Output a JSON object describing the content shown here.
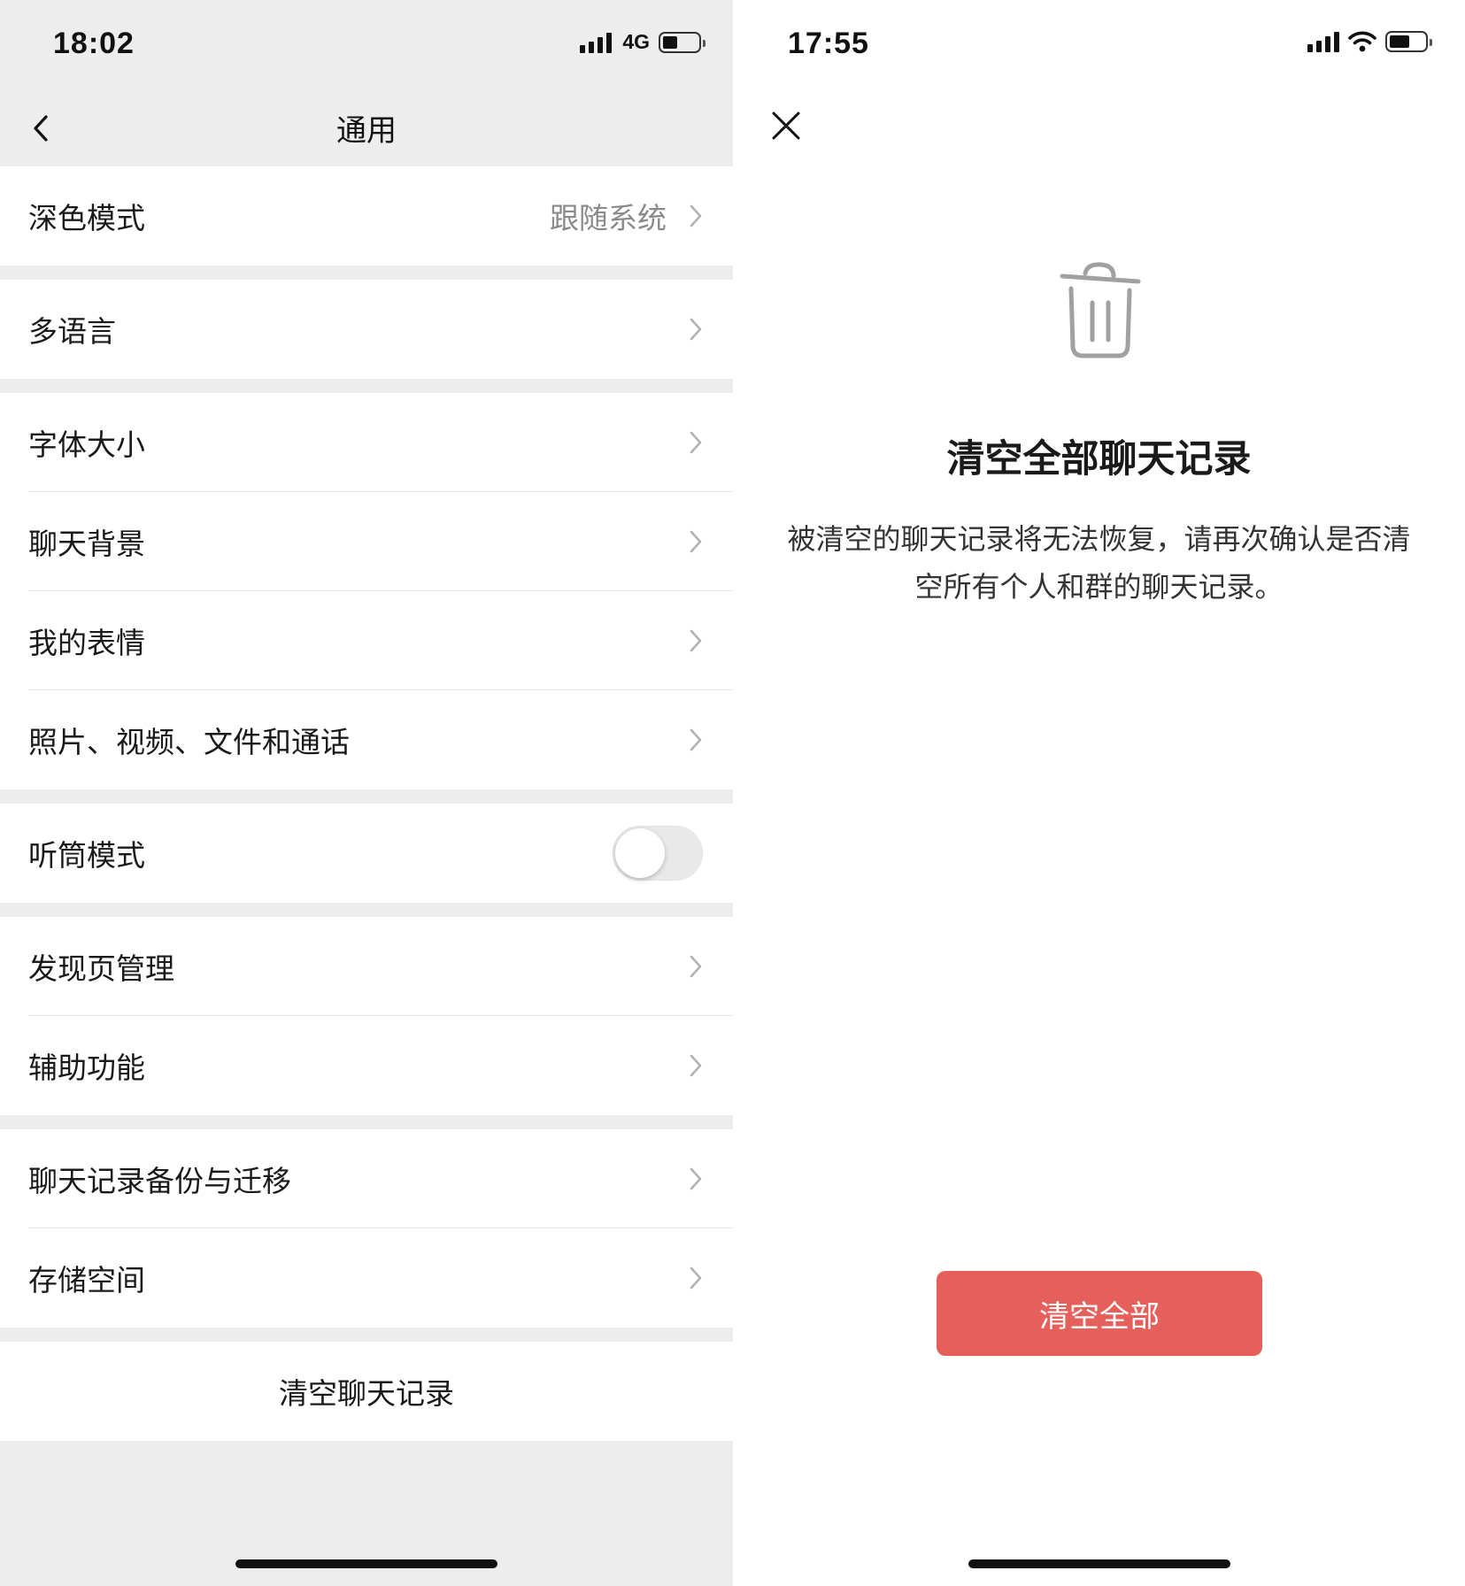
{
  "left_screen": {
    "status_bar": {
      "time": "18:02",
      "network": "4G",
      "battery_icon": "battery-icon",
      "signal_icon": "signal-icon"
    },
    "nav": {
      "title": "通用",
      "back_icon": "chevron-left-icon"
    },
    "groups": [
      {
        "items": [
          {
            "label": "深色模式",
            "value": "跟随系统"
          }
        ]
      },
      {
        "items": [
          {
            "label": "多语言"
          }
        ]
      },
      {
        "items": [
          {
            "label": "字体大小"
          },
          {
            "label": "聊天背景"
          },
          {
            "label": "我的表情"
          },
          {
            "label": "照片、视频、文件和通话"
          }
        ]
      },
      {
        "items": [
          {
            "label": "听筒模式",
            "toggle": false
          }
        ]
      },
      {
        "items": [
          {
            "label": "发现页管理"
          },
          {
            "label": "辅助功能"
          }
        ]
      },
      {
        "items": [
          {
            "label": "聊天记录备份与迁移"
          },
          {
            "label": "存储空间"
          }
        ]
      },
      {
        "items": [
          {
            "label": "清空聊天记录"
          }
        ]
      }
    ]
  },
  "right_screen": {
    "status_bar": {
      "time": "17:55",
      "signal_icon": "signal-icon",
      "wifi_icon": "wifi-icon",
      "battery_icon": "battery-icon"
    },
    "close_icon": "close-icon",
    "trash_icon": "trash-icon",
    "title": "清空全部聊天记录",
    "description": "被清空的聊天记录将无法恢复，请再次确认是否清空所有个人和群的聊天记录。",
    "button_label": "清空全部"
  },
  "colors": {
    "background_gray": "#ededed",
    "danger": "#e5605a",
    "secondary_text": "#8a8a8a"
  }
}
